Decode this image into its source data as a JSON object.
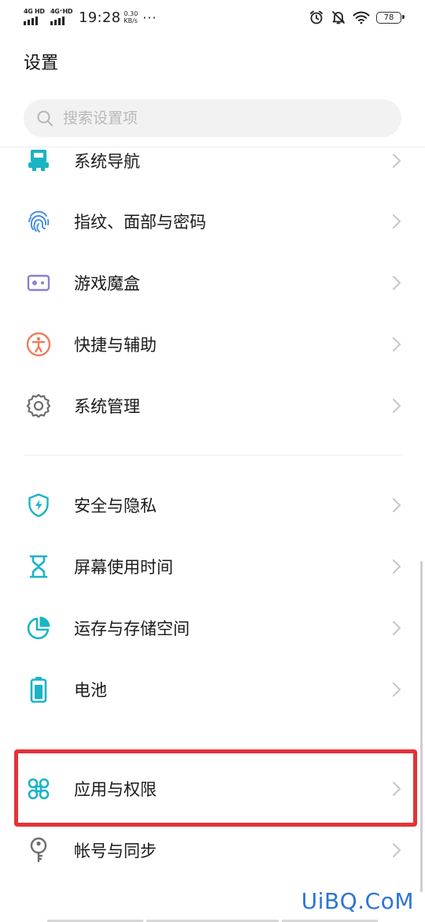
{
  "status_bar": {
    "sim1_tag": "4G HD",
    "sim2_tag": "4G⁺HD",
    "time": "19:28",
    "speed_value": "0.30",
    "speed_unit": "KB/s",
    "more": "···",
    "battery": "78"
  },
  "header": {
    "title": "设置"
  },
  "search": {
    "placeholder": "搜索设置项"
  },
  "sections": [
    {
      "items": [
        {
          "label": "系统导航",
          "icon": "navigation-icon",
          "color": "#1ab4c4"
        },
        {
          "label": "指纹、面部与密码",
          "icon": "fingerprint-icon",
          "color": "#4a90e2"
        },
        {
          "label": "游戏魔盒",
          "icon": "game-box-icon",
          "color": "#8b7fd6"
        },
        {
          "label": "快捷与辅助",
          "icon": "accessibility-icon",
          "color": "#ef7c5c"
        },
        {
          "label": "系统管理",
          "icon": "gear-icon",
          "color": "#6f6f6f"
        }
      ]
    },
    {
      "items": [
        {
          "label": "安全与隐私",
          "icon": "shield-icon",
          "color": "#1ab4c4"
        },
        {
          "label": "屏幕使用时间",
          "icon": "hourglass-icon",
          "color": "#1ab4c4"
        },
        {
          "label": "运存与存储空间",
          "icon": "storage-pie-icon",
          "color": "#1ab4c4"
        },
        {
          "label": "电池",
          "icon": "battery-icon",
          "color": "#1ab4c4"
        }
      ]
    },
    {
      "items": [
        {
          "label": "应用与权限",
          "icon": "apps-icon",
          "color": "#1ab4c4",
          "highlighted": true
        },
        {
          "label": "帐号与同步",
          "icon": "key-icon",
          "color": "#6f6f6f"
        }
      ]
    }
  ],
  "highlight_color": "#e53238",
  "watermark": "UiBQ.CoM"
}
